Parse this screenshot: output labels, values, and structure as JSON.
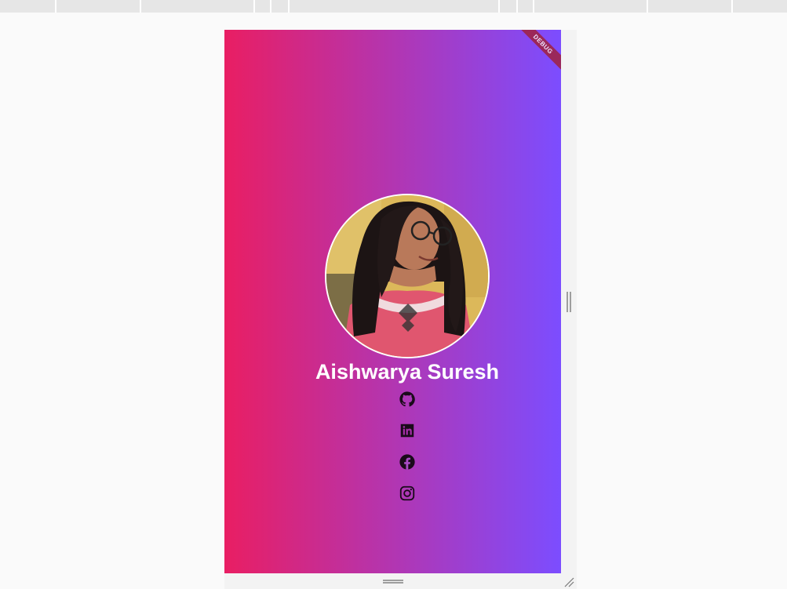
{
  "profile": {
    "name": "Aishwarya Suresh"
  },
  "debug_banner": {
    "label": "DEBUG"
  },
  "social_links": [
    {
      "icon": "github-icon"
    },
    {
      "icon": "linkedin-icon"
    },
    {
      "icon": "facebook-icon"
    },
    {
      "icon": "instagram-icon"
    }
  ],
  "colors": {
    "gradient_start": "#e91e63",
    "gradient_end": "#7c4dff",
    "name_text": "#ffffff",
    "icon": "#1a0a1a"
  }
}
